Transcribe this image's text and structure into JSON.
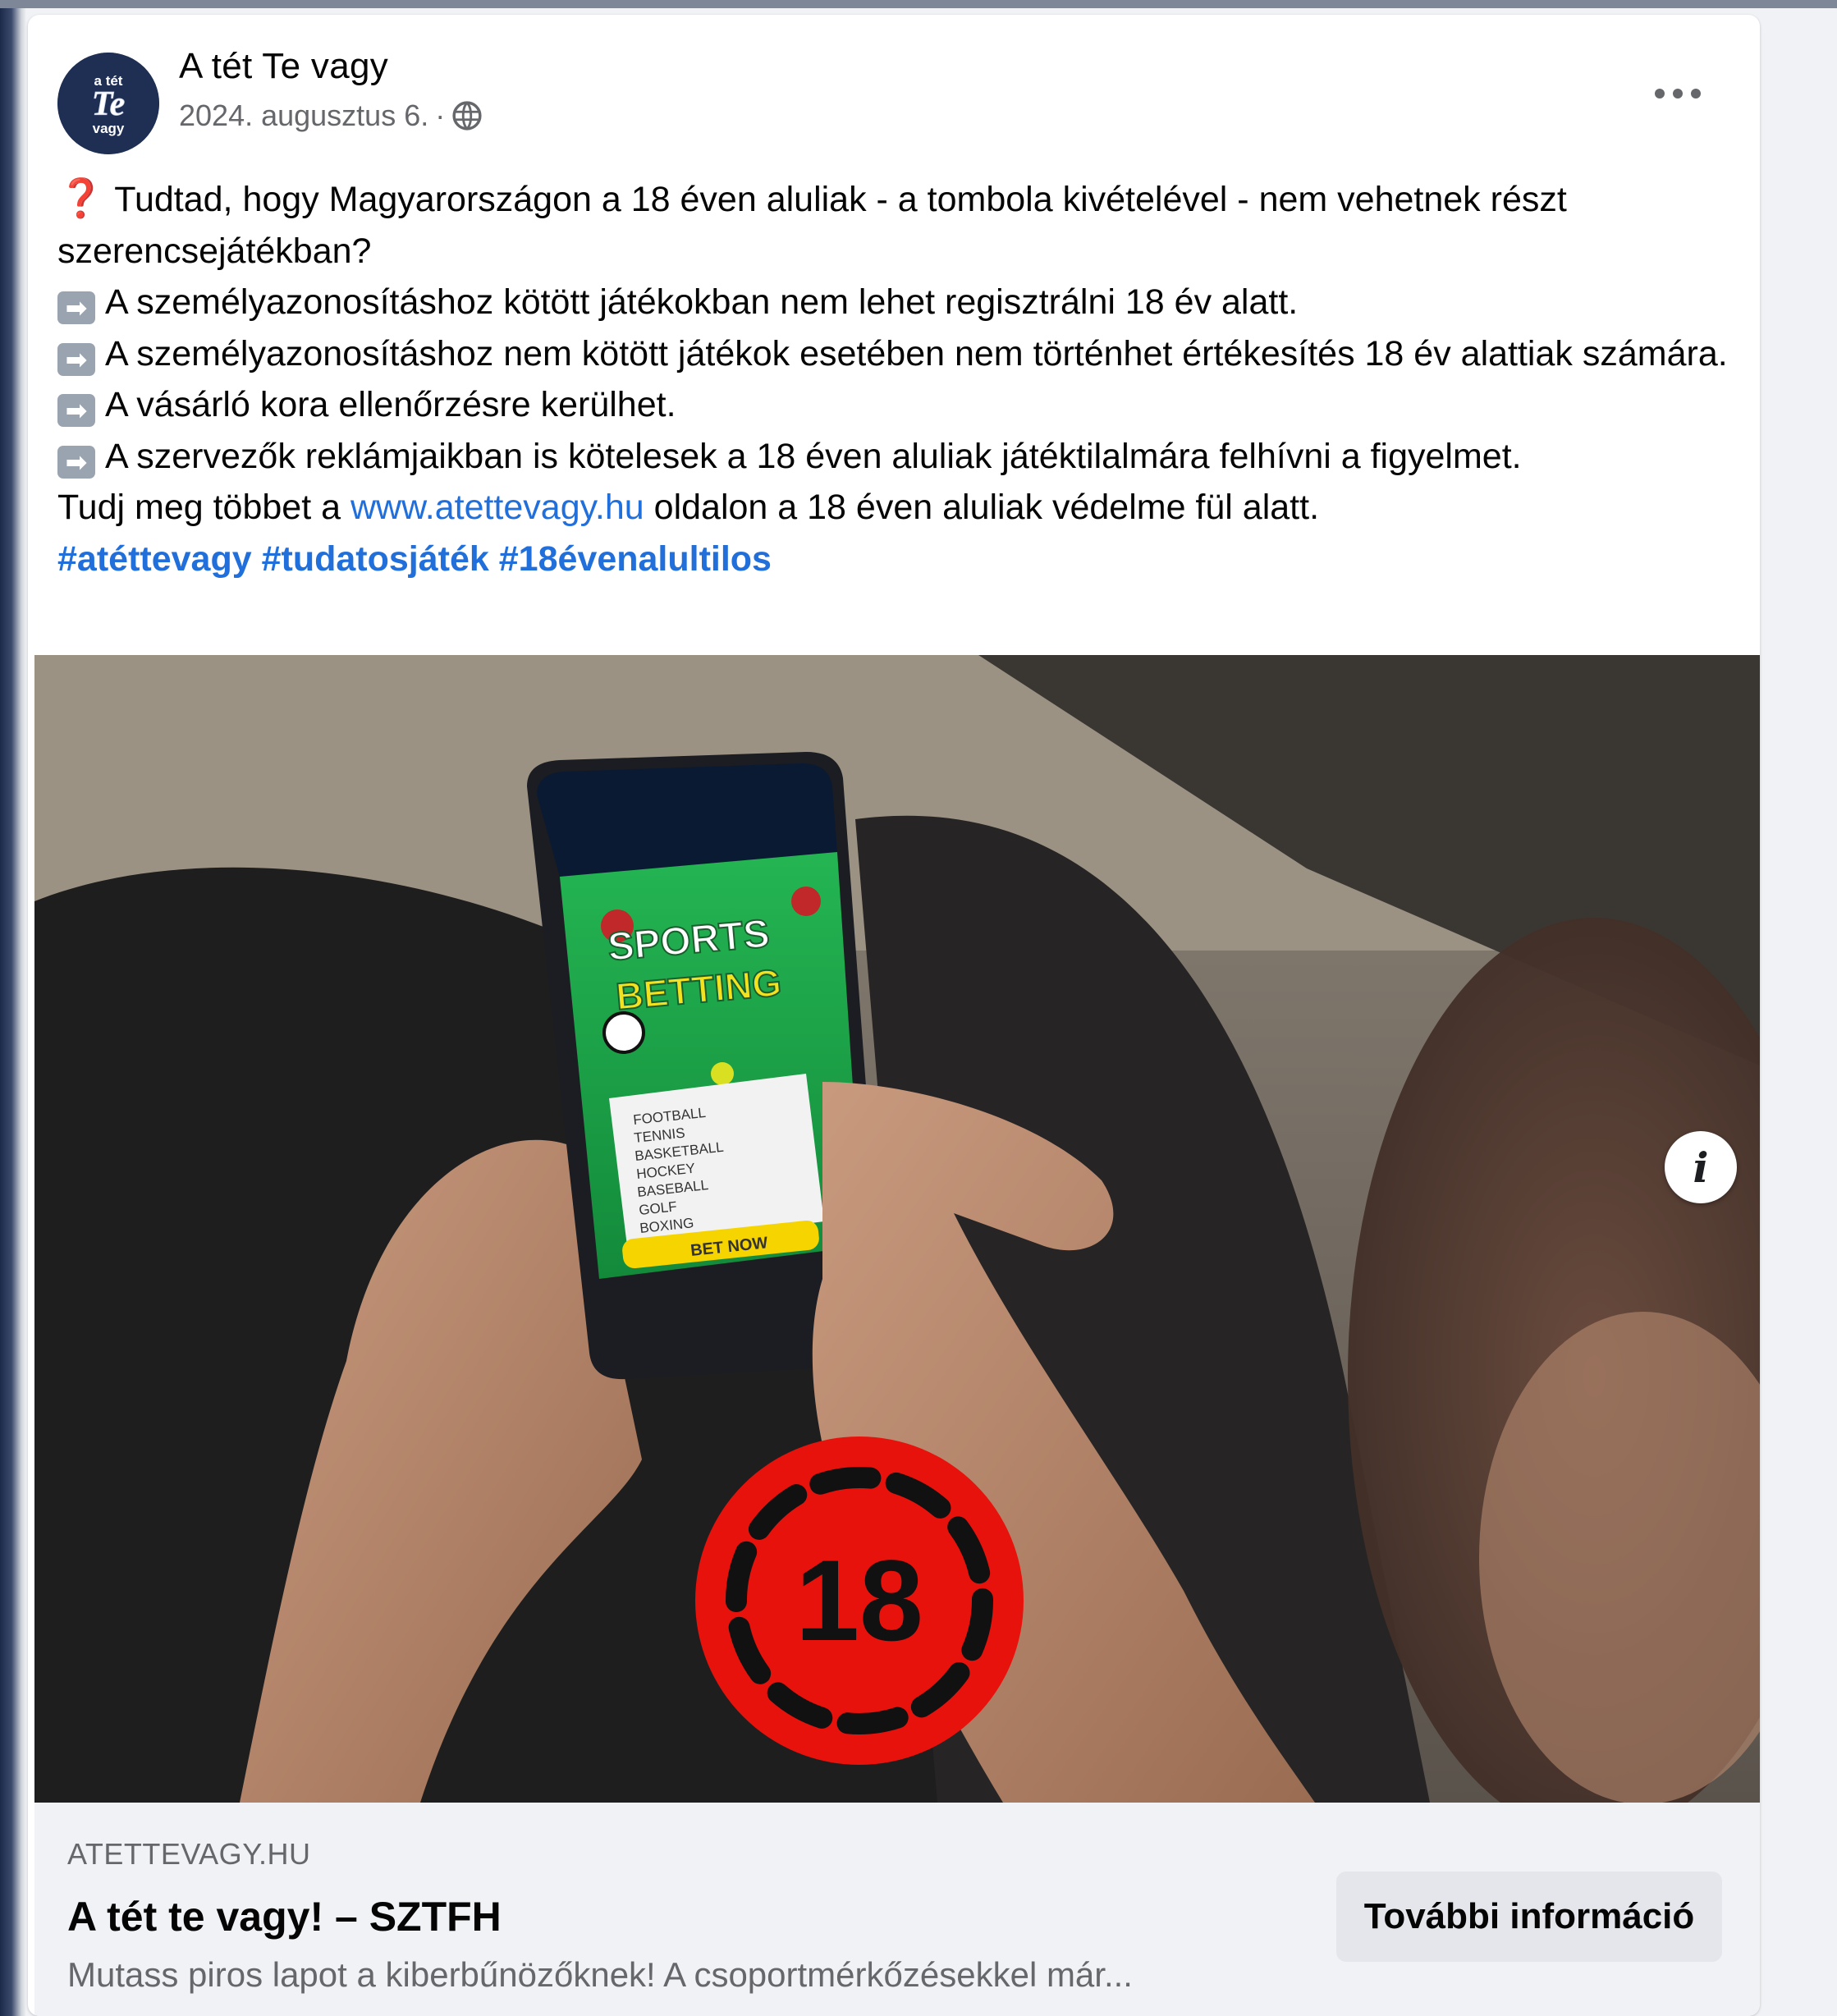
{
  "post": {
    "page_name": "A tét Te vagy",
    "date": "2024. augusztus 6.",
    "separator": "·",
    "avatar": {
      "line1": "a tét",
      "line2": "Te",
      "line3": "vagy"
    },
    "question_mark": "❓",
    "arrow_glyph": "➡",
    "lines": {
      "q": "Tudtad, hogy Magyarországon a 18 éven aluliak - a tombola kivételével - nem vehetnek részt szerencsejátékban?",
      "a1": "A személyazonosításhoz kötött játékokban nem lehet regisztrálni 18 év alatt.",
      "a2": "A személyazonosításhoz nem kötött játékok esetében nem történhet értékesítés 18 év alattiak számára.",
      "a3": "A vásárló kora ellenőrzésre kerülhet.",
      "a4": "A szervezők reklámjaikban is kötelesek a 18 éven aluliak játéktilalmára felhívni a figyelmet.",
      "tudj_pre": "Tudj meg többet a",
      "tudj_link": "www.atettevagy.hu",
      "tudj_post": "oldalon a 18 éven aluliak védelme fül alatt."
    },
    "hashtags": [
      "#atéttevagy",
      "#tudatosjáték",
      "#18évenalultilos"
    ]
  },
  "image": {
    "phone_title1": "SPORTS",
    "phone_title2": "BETTING",
    "phone_list": [
      "FOOTBALL",
      "TENNIS",
      "BASKETBALL",
      "HOCKEY",
      "BASEBALL",
      "GOLF",
      "BOXING"
    ],
    "phone_button": "BET NOW",
    "badge_number": "18",
    "info_glyph": "i"
  },
  "preview": {
    "domain": "ATETTEVAGY.HU",
    "headline": "A tét te vagy! – SZTFH",
    "description": "Mutass piros lapot a kiberbűnözőknek! A csoportmérkőzésekkel már...",
    "cta_label": "További információ"
  },
  "colors": {
    "link": "#216fdb",
    "badge_red": "#e8120c",
    "phone_green": "#1fa84a",
    "cta_bg": "#e4e6eb"
  }
}
